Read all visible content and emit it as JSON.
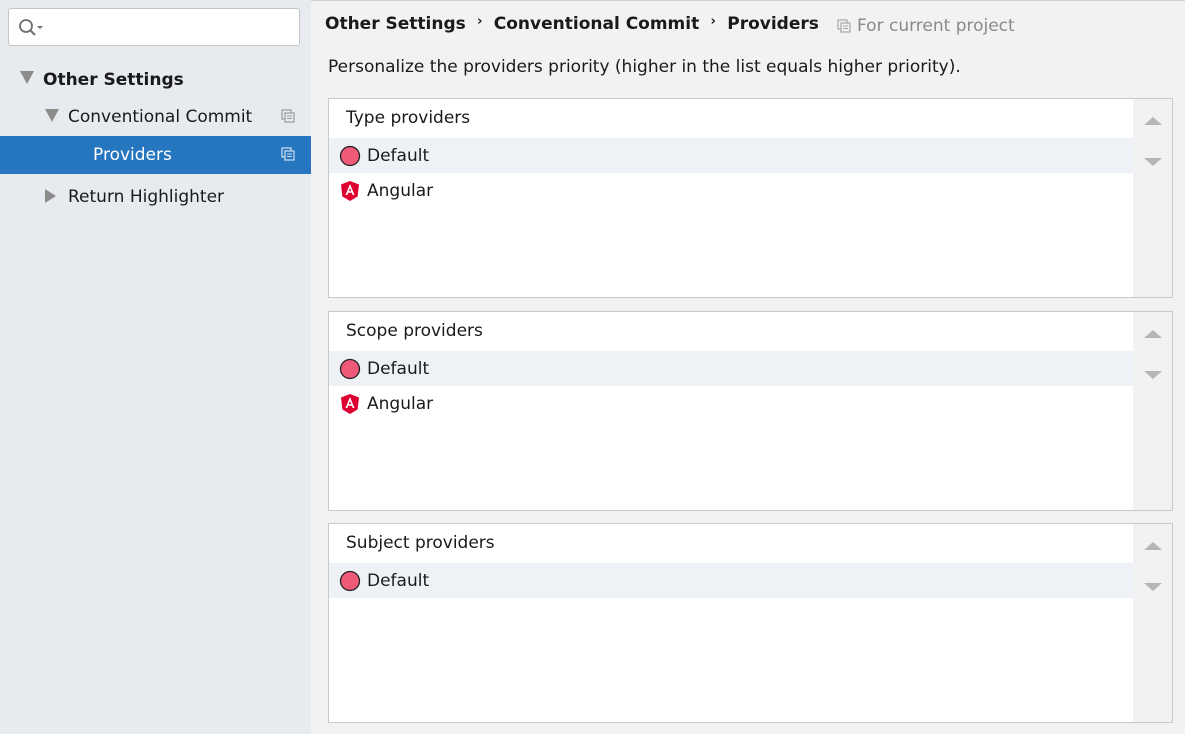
{
  "search": {
    "value": "",
    "placeholder": ""
  },
  "sidebar": {
    "items": [
      {
        "label": "Other Settings"
      },
      {
        "label": "Conventional Commit"
      },
      {
        "label": "Providers"
      },
      {
        "label": "Return Highlighter"
      }
    ]
  },
  "breadcrumb": {
    "items": [
      "Other Settings",
      "Conventional Commit",
      "Providers"
    ],
    "separator": "›"
  },
  "scope_label": "For current project",
  "description": "Personalize the providers priority (higher in the list equals higher priority).",
  "panels": [
    {
      "title": "Type providers",
      "items": [
        {
          "label": "Default",
          "icon": "default-provider-icon"
        },
        {
          "label": "Angular",
          "icon": "angular-icon"
        }
      ]
    },
    {
      "title": "Scope providers",
      "items": [
        {
          "label": "Default",
          "icon": "default-provider-icon"
        },
        {
          "label": "Angular",
          "icon": "angular-icon"
        }
      ]
    },
    {
      "title": "Subject providers",
      "items": [
        {
          "label": "Default",
          "icon": "default-provider-icon"
        }
      ]
    }
  ],
  "colors": {
    "selection": "#2675bf",
    "default_icon": "#ef5a78",
    "angular": "#dd0031"
  }
}
